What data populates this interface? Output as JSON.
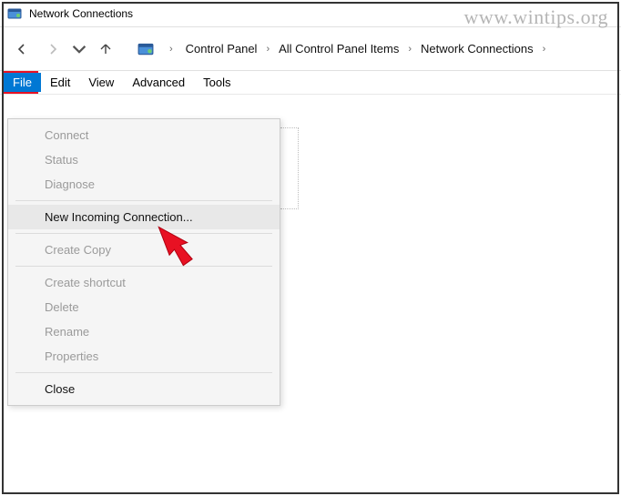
{
  "window": {
    "title": "Network Connections"
  },
  "watermark": "www.wintips.org",
  "breadcrumb": {
    "items": [
      "Control Panel",
      "All Control Panel Items",
      "Network Connections"
    ]
  },
  "menubar": {
    "items": [
      "File",
      "Edit",
      "View",
      "Advanced",
      "Tools"
    ],
    "active_index": 0
  },
  "file_menu": {
    "connect": "Connect",
    "status": "Status",
    "diagnose": "Diagnose",
    "new_incoming": "New Incoming Connection...",
    "create_copy": "Create Copy",
    "create_shortcut": "Create shortcut",
    "delete": "Delete",
    "rename": "Rename",
    "properties": "Properties",
    "close": "Close"
  }
}
